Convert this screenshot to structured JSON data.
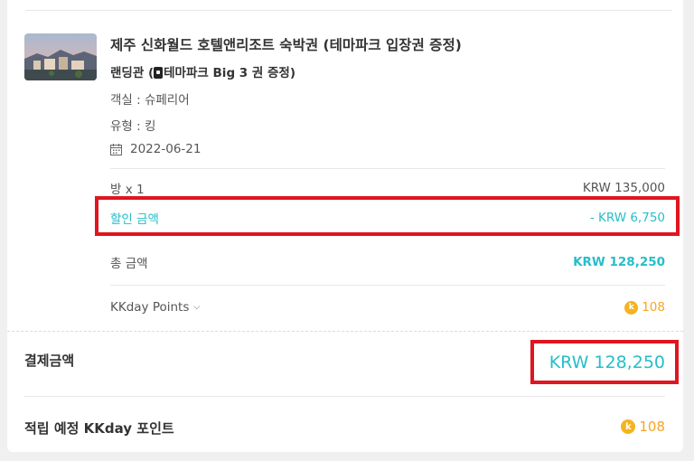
{
  "product": {
    "title": "제주 신화월드 호텔앤리조트 숙박권 (테마파크 입장권 증정)",
    "package": "랜딩관 (",
    "package_rest": "테마파크 Big 3 권 증정)",
    "room_spec": "객실 : 슈페리어",
    "type_spec": "유형 : 킹",
    "date": "2022-06-21"
  },
  "price_rows": {
    "room_label": "방 x 1",
    "room_amount": "KRW 135,000",
    "discount_label": "할인 금액",
    "discount_amount": "- KRW 6,750",
    "total_label": "총 금액",
    "total_amount": "KRW 128,250",
    "points_label": "KKday Points",
    "points_value": "108"
  },
  "payment": {
    "label": "결제금액",
    "amount": "KRW 128,250"
  },
  "earn": {
    "label": "적립 예정 KKday 포인트",
    "value": "108"
  },
  "icons": {
    "coin_glyph": "k"
  },
  "colors": {
    "accent": "#26bec9",
    "points": "#f5a623",
    "highlight": "#e0151f"
  }
}
